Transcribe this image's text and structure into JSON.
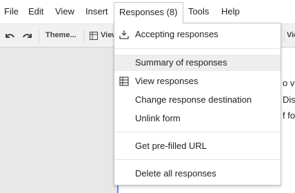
{
  "menubar": {
    "items": [
      {
        "label": "File"
      },
      {
        "label": "Edit"
      },
      {
        "label": "View"
      },
      {
        "label": "Insert"
      },
      {
        "label": "Responses (8)"
      },
      {
        "label": "Tools"
      },
      {
        "label": "Help"
      }
    ]
  },
  "toolbar": {
    "undo_icon": "undo-icon",
    "redo_icon": "redo-icon",
    "theme_label": "Theme...",
    "view_label_partial": "View",
    "right_view_label_partial": "Vie"
  },
  "responses_menu": {
    "items": [
      {
        "label": "Accepting responses",
        "icon": "download-tray-icon"
      },
      {
        "label": "Summary of responses"
      },
      {
        "label": "View responses",
        "icon": "spreadsheet-grid-icon"
      },
      {
        "label": "Change response destination"
      },
      {
        "label": "Unlink form"
      },
      {
        "label": "Get pre-filled URL"
      },
      {
        "label": "Delete all responses"
      }
    ]
  },
  "background_peek": {
    "line1": "o vi",
    "line2": "Dis",
    "line3": "f fo"
  },
  "colors": {
    "accent": "#4d90fe",
    "toolbar_bg": "#f1f1f1",
    "highlight_bg": "#eeeeee"
  }
}
